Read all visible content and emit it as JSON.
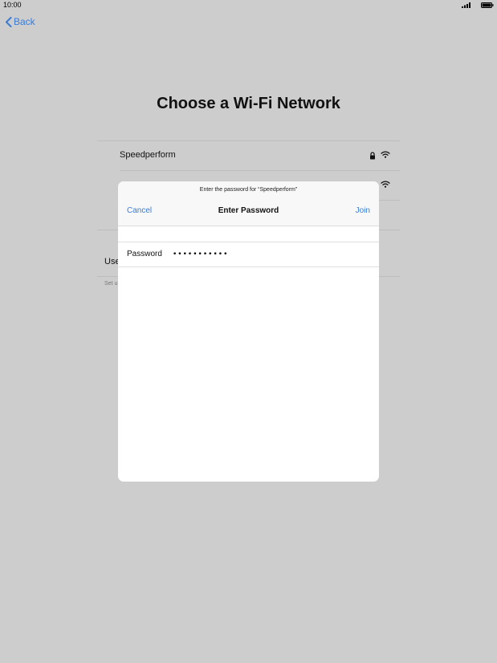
{
  "status_bar": {
    "time": "10:00"
  },
  "nav": {
    "back_label": "Back"
  },
  "page": {
    "title": "Choose a Wi-Fi Network"
  },
  "networks": [
    {
      "name": "Speedperform",
      "secured": true
    },
    {
      "name": "",
      "secured": false
    }
  ],
  "background_partial": {
    "other_label_fragment": "Use",
    "footer_fragment": "Set u"
  },
  "dialog": {
    "prompt": "Enter the password for “Speedperform”",
    "title": "Enter Password",
    "cancel_label": "Cancel",
    "join_label": "Join",
    "password_label": "Password",
    "password_value": "•••••••••••"
  },
  "colors": {
    "background": "#cdcdcd",
    "accent": "#3a7bd5",
    "dialog": "#ffffff"
  },
  "icons": [
    "signal-icon",
    "battery-icon",
    "chevron-left-icon",
    "lock-icon",
    "wifi-icon"
  ]
}
